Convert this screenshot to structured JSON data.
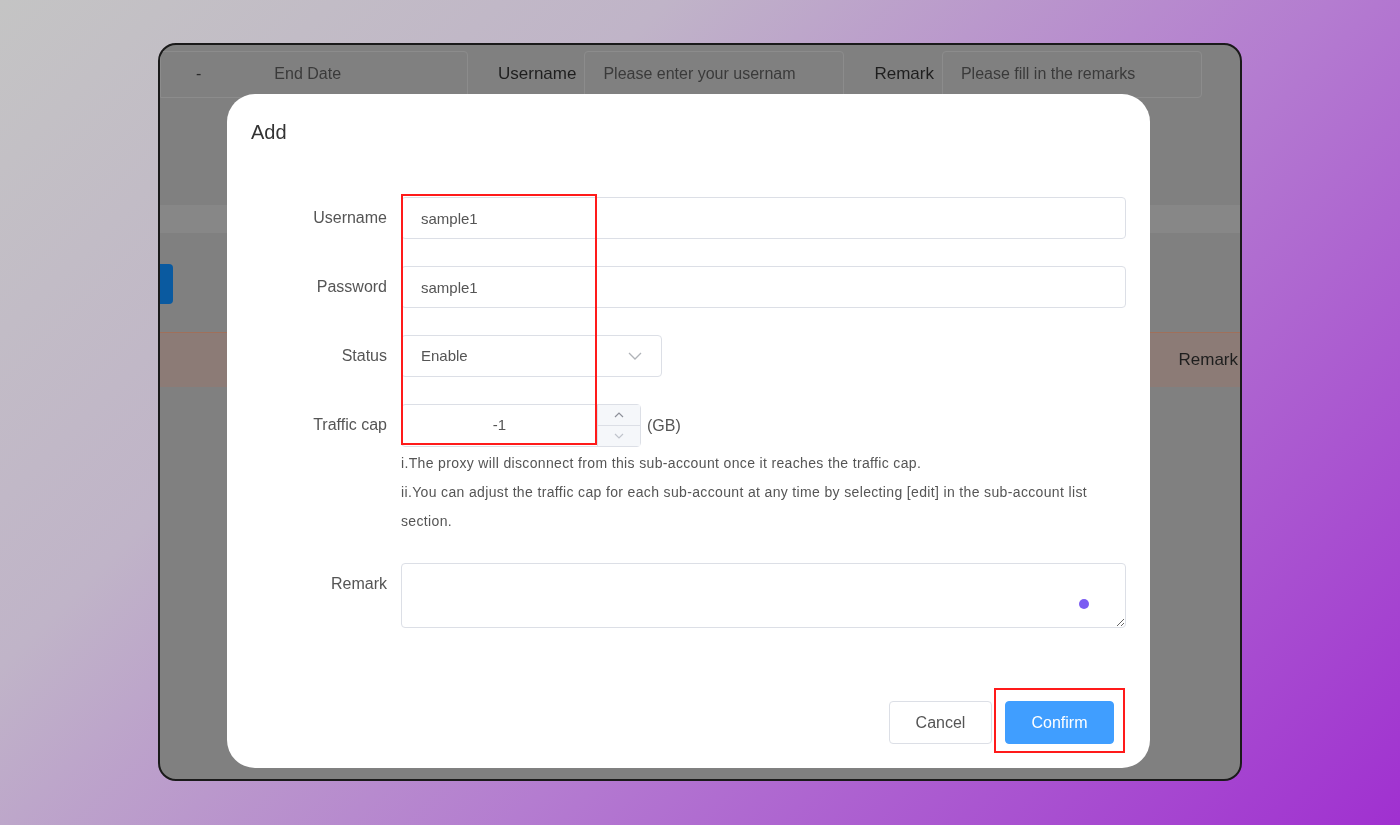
{
  "background_page": {
    "date_range": {
      "separator": "-",
      "end_placeholder": "End Date"
    },
    "filters": [
      {
        "label": "Username",
        "placeholder": "Please enter your usernam"
      },
      {
        "label": "Remark",
        "placeholder": "Please fill in the remarks"
      }
    ],
    "table_header": {
      "last_column": "Remark"
    }
  },
  "dialog": {
    "title": "Add",
    "fields": [
      {
        "kind": "text",
        "label": "Username",
        "value": "sample1"
      },
      {
        "kind": "text",
        "label": "Password",
        "value": "sample1"
      },
      {
        "kind": "select",
        "label": "Status",
        "value": "Enable"
      },
      {
        "kind": "number",
        "label": "Traffic cap",
        "value": "-1",
        "unit": "(GB)",
        "hints": [
          "i.The proxy will disconnect from this sub-account once it reaches the traffic cap.",
          "ii.You can adjust the traffic cap for each sub-account at any time by selecting [edit] in the sub-account list section."
        ]
      },
      {
        "kind": "textarea",
        "label": "Remark"
      }
    ],
    "buttons": [
      {
        "kind": "secondary",
        "label": "Cancel"
      },
      {
        "kind": "primary",
        "label": "Confirm"
      }
    ],
    "highlights": {
      "fields": true,
      "confirm_button": true
    }
  }
}
